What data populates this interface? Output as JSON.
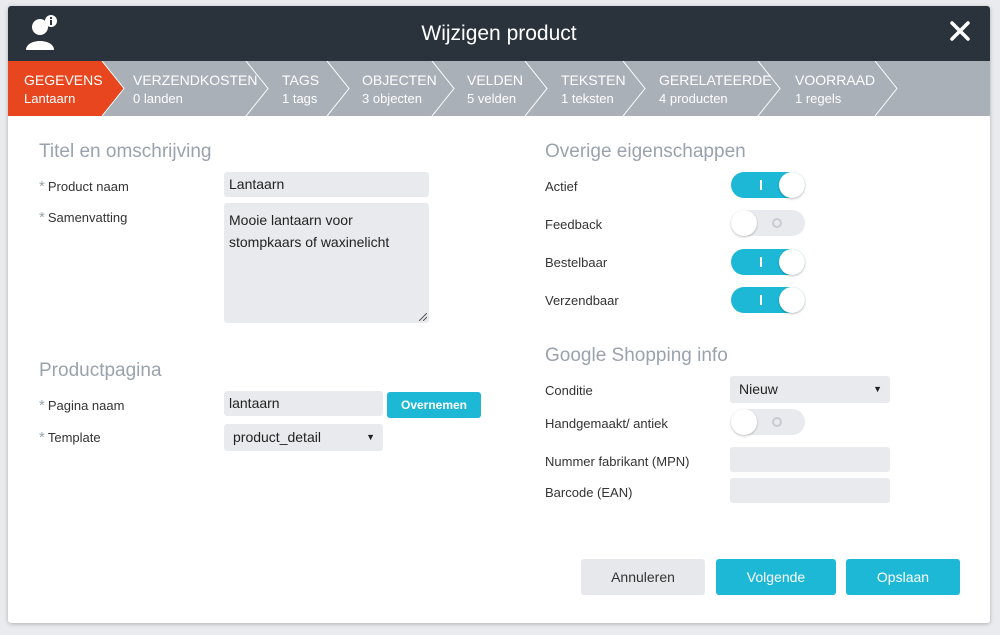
{
  "dialog": {
    "title": "Wijzigen product",
    "icons": {
      "user": "user-info-icon",
      "close": "close-icon"
    }
  },
  "steps": [
    {
      "label": "GEGEVENS",
      "sub": "Lantaarn",
      "active": true
    },
    {
      "label": "VERZENDKOSTEN",
      "sub": "0 landen"
    },
    {
      "label": "TAGS",
      "sub": "1 tags"
    },
    {
      "label": "OBJECTEN",
      "sub": "3 objecten"
    },
    {
      "label": "VELDEN",
      "sub": "5 velden"
    },
    {
      "label": "TEKSTEN",
      "sub": "1 teksten"
    },
    {
      "label": "GERELATEERDE",
      "sub": "4 producten"
    },
    {
      "label": "VOORRAAD",
      "sub": "1 regels"
    }
  ],
  "left": {
    "title_section": "Titel en omschrijving",
    "product_name_label": "Product naam",
    "product_name_value": "Lantaarn",
    "summary_label": "Samenvatting",
    "summary_value": "Mooie lantaarn voor stompkaars of waxinelicht",
    "page_section": "Productpagina",
    "page_name_label": "Pagina naam",
    "page_name_value": "lantaarn",
    "adopt_button": "Overnemen",
    "template_label": "Template",
    "template_value": "product_detail",
    "required_mark": "*"
  },
  "right": {
    "props_section": "Overige eigenschappen",
    "toggles": [
      {
        "label": "Actief",
        "on": true
      },
      {
        "label": "Feedback",
        "on": false
      },
      {
        "label": "Bestelbaar",
        "on": true
      },
      {
        "label": "Verzendbaar",
        "on": true
      }
    ],
    "google_section": "Google Shopping info",
    "condition_label": "Conditie",
    "condition_value": "Nieuw",
    "handmade_label": "Handgemaakt/ antiek",
    "handmade_on": false,
    "mpn_label": "Nummer fabrikant (MPN)",
    "mpn_value": "",
    "ean_label": "Barcode (EAN)",
    "ean_value": ""
  },
  "footer": {
    "cancel": "Annuleren",
    "next": "Volgende",
    "save": "Opslaan"
  },
  "colors": {
    "accent": "#1cb8d6",
    "active_step": "#e8461e",
    "titlebar": "#2a323b",
    "steps_bg": "#a9b0b8"
  }
}
